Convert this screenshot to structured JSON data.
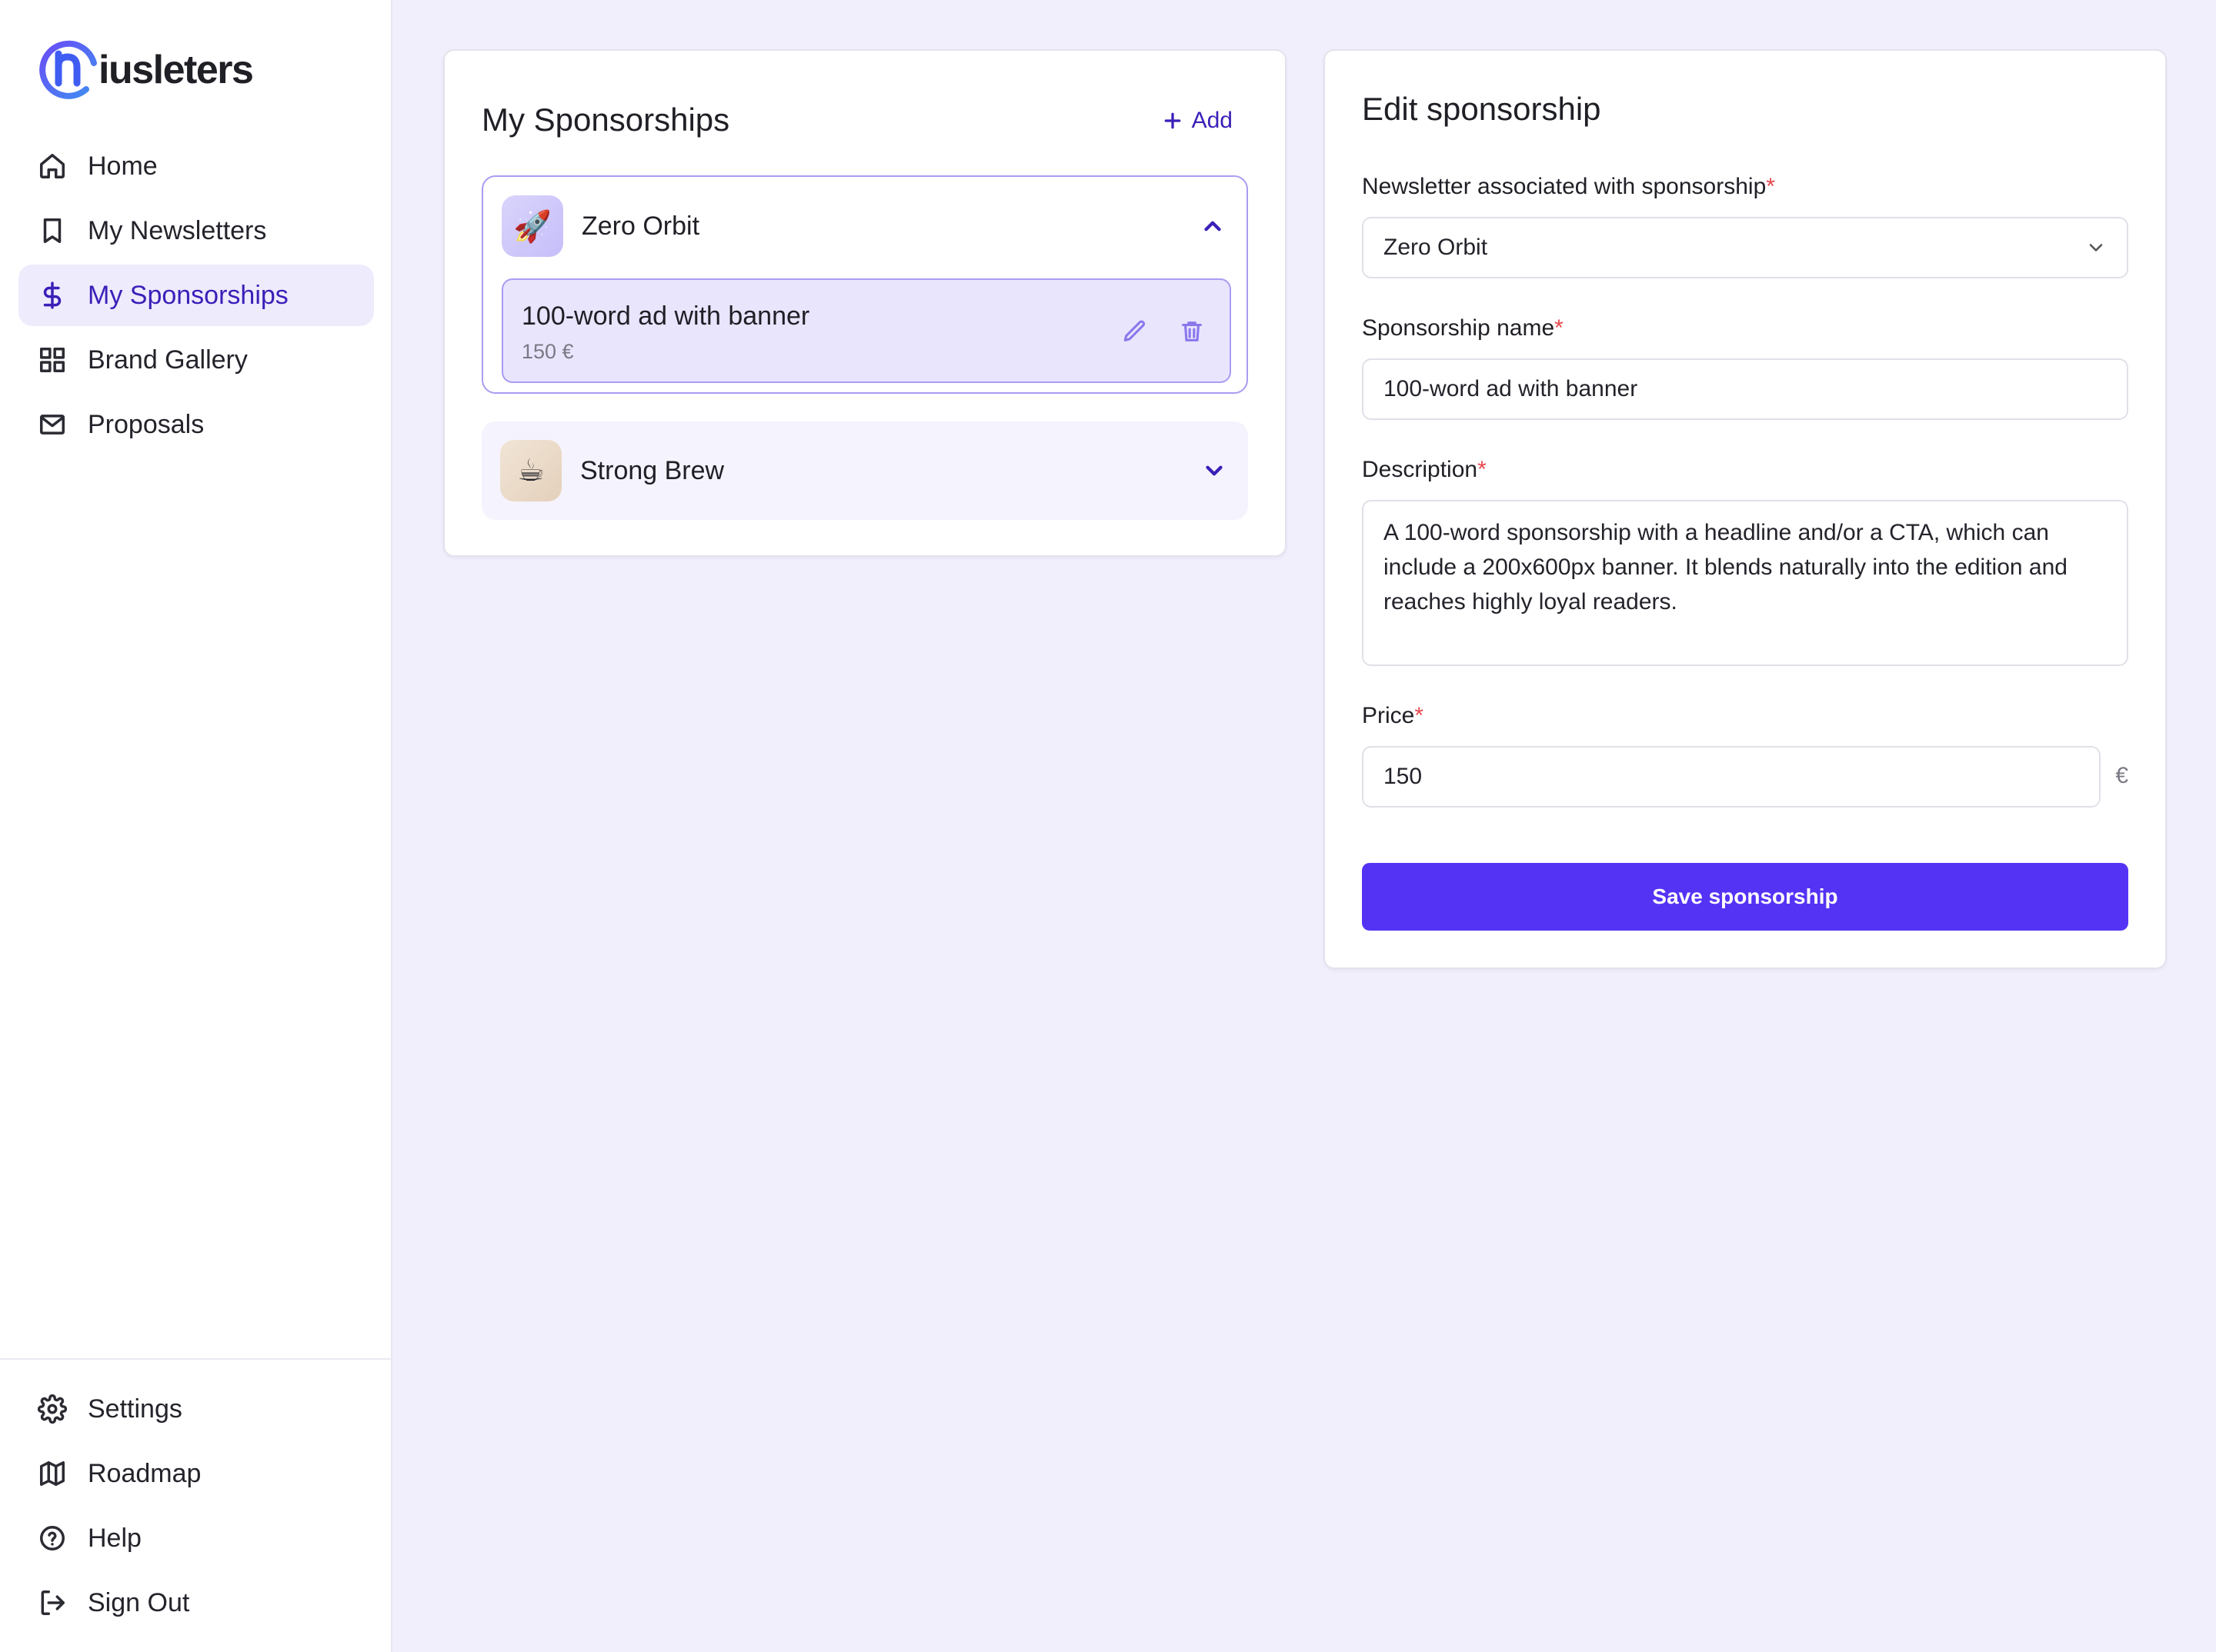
{
  "brand": {
    "logo_text": "iusleters"
  },
  "sidebar": {
    "items": [
      {
        "label": "Home",
        "icon": "home-icon"
      },
      {
        "label": "My Newsletters",
        "icon": "bookmark-icon"
      },
      {
        "label": "My Sponsorships",
        "icon": "dollar-icon",
        "active": true
      },
      {
        "label": "Brand Gallery",
        "icon": "grid-icon"
      },
      {
        "label": "Proposals",
        "icon": "mail-icon"
      }
    ],
    "bottom_items": [
      {
        "label": "Settings",
        "icon": "gear-icon"
      },
      {
        "label": "Roadmap",
        "icon": "map-icon"
      },
      {
        "label": "Help",
        "icon": "help-circle-icon"
      },
      {
        "label": "Sign Out",
        "icon": "sign-out-icon"
      }
    ]
  },
  "sponsorships_panel": {
    "title": "My Sponsorships",
    "add_label": "Add",
    "groups": [
      {
        "name": "Zero Orbit",
        "avatar": "🚀",
        "expanded": true,
        "items": [
          {
            "title": "100-word ad with banner",
            "price": "150 €"
          }
        ]
      },
      {
        "name": "Strong Brew",
        "avatar": "☕",
        "expanded": false
      }
    ]
  },
  "edit_panel": {
    "title": "Edit sponsorship",
    "newsletter_label": "Newsletter associated with sponsorship",
    "newsletter_value": "Zero Orbit",
    "name_label": "Sponsorship name",
    "name_value": "100-word ad with banner",
    "description_label": "Description",
    "description_value": "A 100-word sponsorship with a headline and/or a CTA, which can include a 200x600px banner. It blends naturally into the edition and reaches highly loyal readers.",
    "price_label": "Price",
    "price_value": "150",
    "currency": "€",
    "required_mark": "*",
    "save_label": "Save sponsorship"
  },
  "colors": {
    "accent": "#5533f5",
    "accent_text": "#3b1fb8",
    "background": "#f1effc",
    "required": "#e5484d"
  }
}
